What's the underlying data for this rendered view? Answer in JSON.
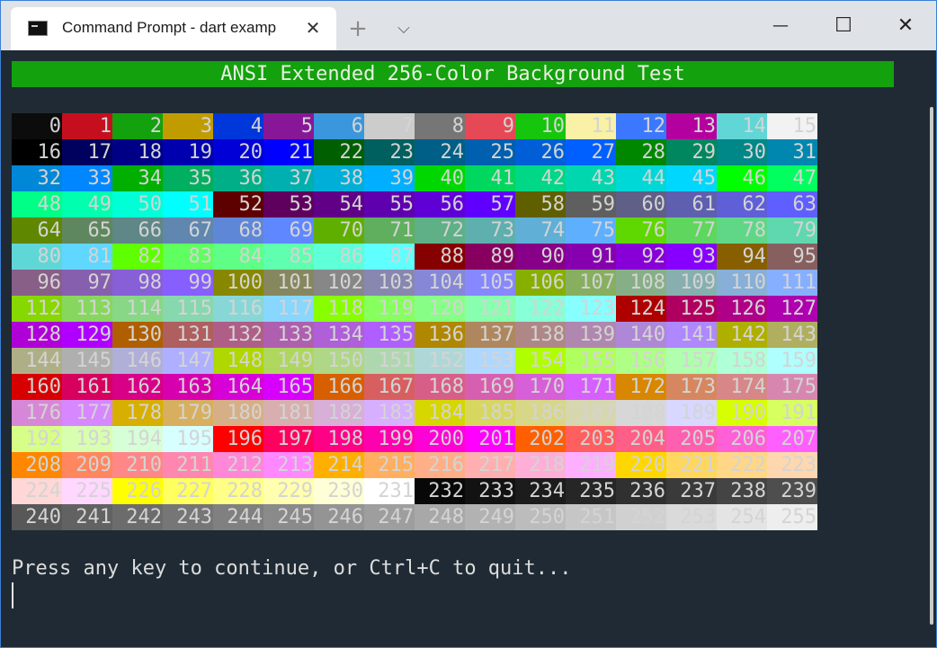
{
  "tab": {
    "title": "Command Prompt - dart  examp",
    "close_glyph": "✕",
    "new_tab_glyph": "+",
    "dropdown_glyph": "⌵"
  },
  "window_controls": {
    "minimize": "—",
    "maximize": "☐",
    "close": "✕"
  },
  "terminal": {
    "header": "ANSI Extended 256-Color Background Test",
    "prompt": "Press any key to continue, or Ctrl+C to quit...",
    "header_bg": "#13a10e",
    "background": "#1f2a34"
  },
  "colors": [
    "#0c0c0c",
    "#c50f1f",
    "#13a10e",
    "#c19c00",
    "#0037da",
    "#881798",
    "#3a96dd",
    "#cccccc",
    "#767676",
    "#e74856",
    "#16c60c",
    "#f9f1a5",
    "#3b78ff",
    "#b4009e",
    "#61d6d6",
    "#f2f2f2",
    "#000000",
    "#00005f",
    "#000087",
    "#0000af",
    "#0000d7",
    "#0000ff",
    "#005f00",
    "#005f5f",
    "#005f87",
    "#005faf",
    "#005fd7",
    "#005fff",
    "#008700",
    "#00875f",
    "#008787",
    "#0087af",
    "#0087d7",
    "#0087ff",
    "#00af00",
    "#00af5f",
    "#00af87",
    "#00afaf",
    "#00afd7",
    "#00afff",
    "#00d700",
    "#00d75f",
    "#00d787",
    "#00d7af",
    "#00d7d7",
    "#00d7ff",
    "#00ff00",
    "#00ff5f",
    "#00ff87",
    "#00ffaf",
    "#00ffd7",
    "#00ffff",
    "#5f0000",
    "#5f005f",
    "#5f0087",
    "#5f00af",
    "#5f00d7",
    "#5f00ff",
    "#5f5f00",
    "#5f5f5f",
    "#5f5f87",
    "#5f5faf",
    "#5f5fd7",
    "#5f5fff",
    "#5f8700",
    "#5f875f",
    "#5f8787",
    "#5f87af",
    "#5f87d7",
    "#5f87ff",
    "#5faf00",
    "#5faf5f",
    "#5faf87",
    "#5fafaf",
    "#5fafd7",
    "#5fafff",
    "#5fd700",
    "#5fd75f",
    "#5fd787",
    "#5fd7af",
    "#5fd7d7",
    "#5fd7ff",
    "#5fff00",
    "#5fff5f",
    "#5fff87",
    "#5fffaf",
    "#5fffd7",
    "#5fffff",
    "#870000",
    "#87005f",
    "#870087",
    "#8700af",
    "#8700d7",
    "#8700ff",
    "#875f00",
    "#875f5f",
    "#875f87",
    "#875faf",
    "#875fd7",
    "#875fff",
    "#878700",
    "#87875f",
    "#878787",
    "#8787af",
    "#8787d7",
    "#8787ff",
    "#87af00",
    "#87af5f",
    "#87af87",
    "#87afaf",
    "#87afd7",
    "#87afff",
    "#87d700",
    "#87d75f",
    "#87d787",
    "#87d7af",
    "#87d7d7",
    "#87d7ff",
    "#87ff00",
    "#87ff5f",
    "#87ff87",
    "#87ffaf",
    "#87ffd7",
    "#87ffff",
    "#af0000",
    "#af005f",
    "#af0087",
    "#af00af",
    "#af00d7",
    "#af00ff",
    "#af5f00",
    "#af5f5f",
    "#af5f87",
    "#af5faf",
    "#af5fd7",
    "#af5fff",
    "#af8700",
    "#af875f",
    "#af8787",
    "#af87af",
    "#af87d7",
    "#af87ff",
    "#afaf00",
    "#afaf5f",
    "#afaf87",
    "#afafaf",
    "#afafd7",
    "#afafff",
    "#afd700",
    "#afd75f",
    "#afd787",
    "#afd7af",
    "#afd7d7",
    "#afd7ff",
    "#afff00",
    "#afff5f",
    "#afff87",
    "#afffaf",
    "#afffd7",
    "#afffff",
    "#d70000",
    "#d7005f",
    "#d70087",
    "#d700af",
    "#d700d7",
    "#d700ff",
    "#d75f00",
    "#d75f5f",
    "#d75f87",
    "#d75faf",
    "#d75fd7",
    "#d75fff",
    "#d78700",
    "#d7875f",
    "#d78787",
    "#d787af",
    "#d787d7",
    "#d787ff",
    "#d7af00",
    "#d7af5f",
    "#d7af87",
    "#d7afaf",
    "#d7afd7",
    "#d7afff",
    "#d7d700",
    "#d7d75f",
    "#d7d787",
    "#d7d7af",
    "#d7d7d7",
    "#d7d7ff",
    "#d7ff00",
    "#d7ff5f",
    "#d7ff87",
    "#d7ffaf",
    "#d7ffd7",
    "#d7ffff",
    "#ff0000",
    "#ff005f",
    "#ff0087",
    "#ff00af",
    "#ff00d7",
    "#ff00ff",
    "#ff5f00",
    "#ff5f5f",
    "#ff5f87",
    "#ff5faf",
    "#ff5fd7",
    "#ff5fff",
    "#ff8700",
    "#ff875f",
    "#ff8787",
    "#ff87af",
    "#ff87d7",
    "#ff87ff",
    "#ffaf00",
    "#ffaf5f",
    "#ffaf87",
    "#ffafaf",
    "#ffafd7",
    "#ffafff",
    "#ffd700",
    "#ffd75f",
    "#ffd787",
    "#ffd7af",
    "#ffd7d7",
    "#ffd7ff",
    "#ffff00",
    "#ffff5f",
    "#ffff87",
    "#ffffaf",
    "#ffffd7",
    "#ffffff",
    "#080808",
    "#121212",
    "#1c1c1c",
    "#262626",
    "#303030",
    "#3a3a3a",
    "#444444",
    "#4e4e4e",
    "#585858",
    "#626262",
    "#6c6c6c",
    "#767676",
    "#808080",
    "#8a8a8a",
    "#949494",
    "#9e9e9e",
    "#a8a8a8",
    "#b2b2b2",
    "#bcbcbc",
    "#c6c6c6",
    "#d0d0d0",
    "#dadada",
    "#e4e4e4",
    "#eeeeee"
  ],
  "label_color": "#d4d4d4"
}
